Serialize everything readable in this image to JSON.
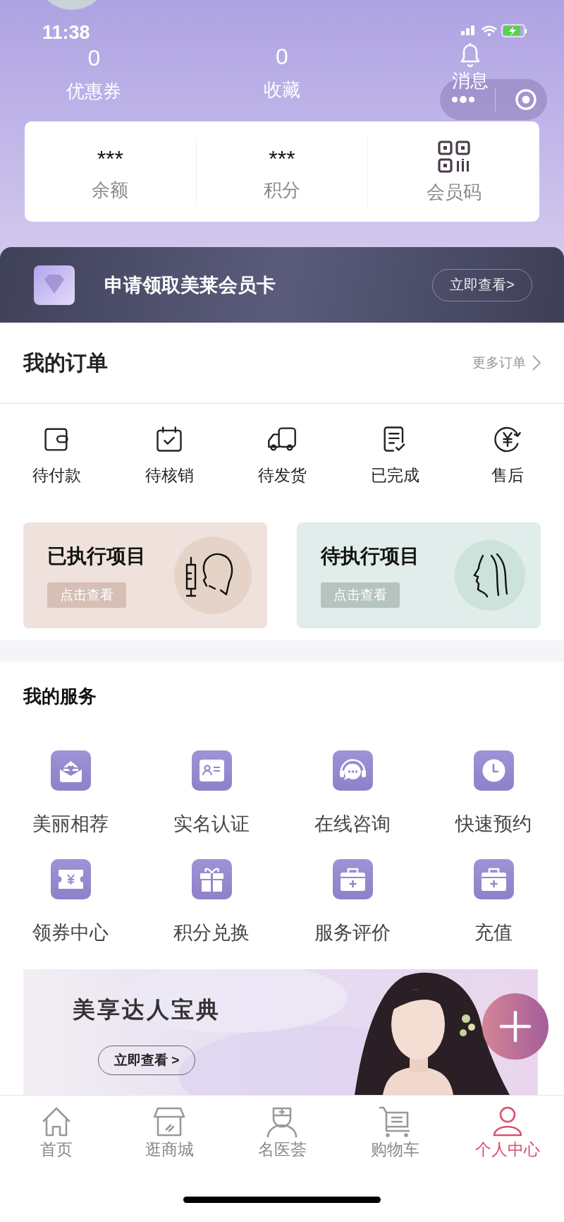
{
  "status_bar": {
    "time": "11:38"
  },
  "header_stats": [
    {
      "kind": "number",
      "value": "0",
      "label": "优惠券"
    },
    {
      "kind": "number",
      "value": "0",
      "label": "收藏"
    },
    {
      "kind": "bell",
      "label": "消息"
    }
  ],
  "account_card": [
    {
      "kind": "value",
      "value": "***",
      "label": "余额"
    },
    {
      "kind": "value",
      "value": "***",
      "label": "积分"
    },
    {
      "kind": "qr",
      "label": "会员码"
    }
  ],
  "member_banner": {
    "title": "申请领取美莱会员卡",
    "button": "立即查看>"
  },
  "orders": {
    "title": "我的订单",
    "more": "更多订单",
    "statuses": [
      {
        "kind": "wallet",
        "label": "待付款"
      },
      {
        "kind": "calendar",
        "label": "待核销"
      },
      {
        "kind": "truck",
        "label": "待发货"
      },
      {
        "kind": "document",
        "label": "已完成"
      },
      {
        "kind": "refund",
        "label": "售后"
      }
    ]
  },
  "projects": [
    {
      "kind": "done",
      "title": "已执行项目",
      "button": "点击查看"
    },
    {
      "kind": "pending",
      "title": "待执行项目",
      "button": "点击查看"
    }
  ],
  "services": {
    "title": "我的服务",
    "items": [
      {
        "kind": "mail",
        "label": "美丽相荐"
      },
      {
        "kind": "idcard",
        "label": "实名认证"
      },
      {
        "kind": "headset",
        "label": "在线咨询"
      },
      {
        "kind": "clock",
        "label": "快速预约"
      },
      {
        "kind": "coupon",
        "label": "领券中心"
      },
      {
        "kind": "gift",
        "label": "积分兑换"
      },
      {
        "kind": "kit",
        "label": "服务评价"
      },
      {
        "kind": "kit",
        "label": "充值"
      }
    ]
  },
  "promo_banner": {
    "kind": "picture",
    "title": "美享达人宝典",
    "button": "立即查看 >"
  },
  "tab_bar": [
    {
      "kind": "home",
      "label": "首页",
      "selected": false
    },
    {
      "kind": "shop",
      "label": "逛商城",
      "selected": false
    },
    {
      "kind": "doctor",
      "label": "名医荟",
      "selected": false
    },
    {
      "kind": "cart",
      "label": "购物车",
      "selected": false
    },
    {
      "kind": "person",
      "label": "个人中心",
      "selected": true
    }
  ]
}
